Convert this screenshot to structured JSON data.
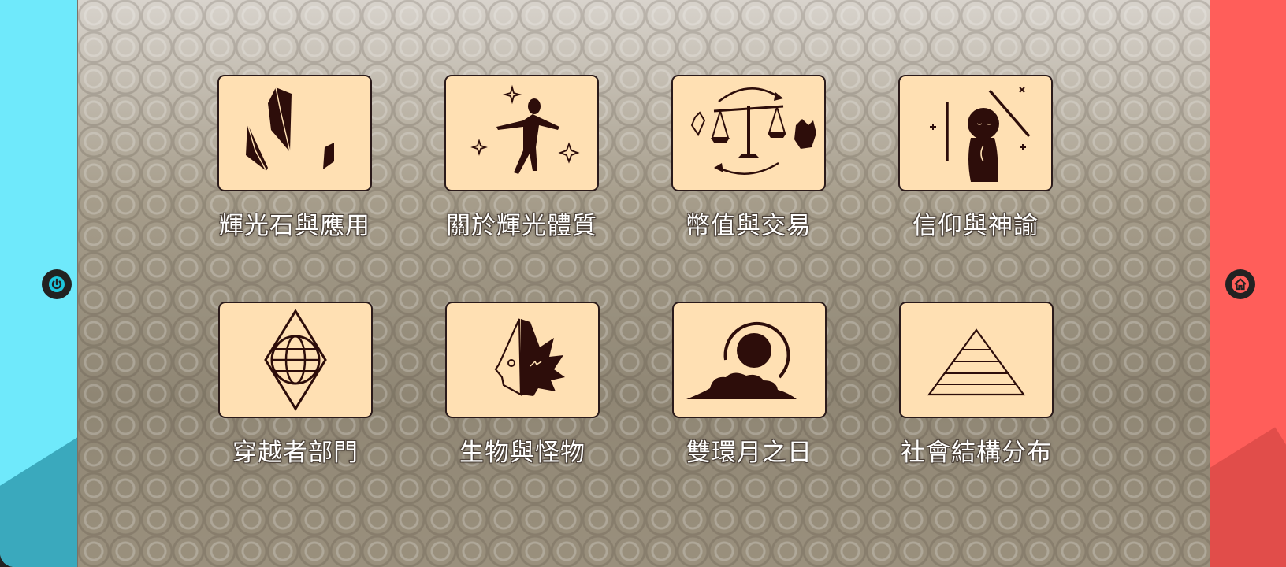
{
  "left_panel": {
    "button_icon": "power-icon",
    "color": "#6fe9fb"
  },
  "right_panel": {
    "button_icon": "home-icon",
    "color": "#ff5e5a"
  },
  "grid": {
    "items": [
      {
        "label": "輝光石與應用",
        "icon": "crystals-icon"
      },
      {
        "label": "關於輝光體質",
        "icon": "glowing-figure-icon"
      },
      {
        "label": "幣值與交易",
        "icon": "balance-scale-icon"
      },
      {
        "label": "信仰與神諭",
        "icon": "praying-figure-icon"
      },
      {
        "label": "穿越者部門",
        "icon": "diamond-globe-icon"
      },
      {
        "label": "生物與怪物",
        "icon": "monster-face-icon"
      },
      {
        "label": "雙環月之日",
        "icon": "ringed-moon-icon"
      },
      {
        "label": "社會結構分布",
        "icon": "pyramid-icon"
      }
    ]
  },
  "colors": {
    "card_bg": "#ffe0b3",
    "icon_ink": "#2d0d0a"
  }
}
